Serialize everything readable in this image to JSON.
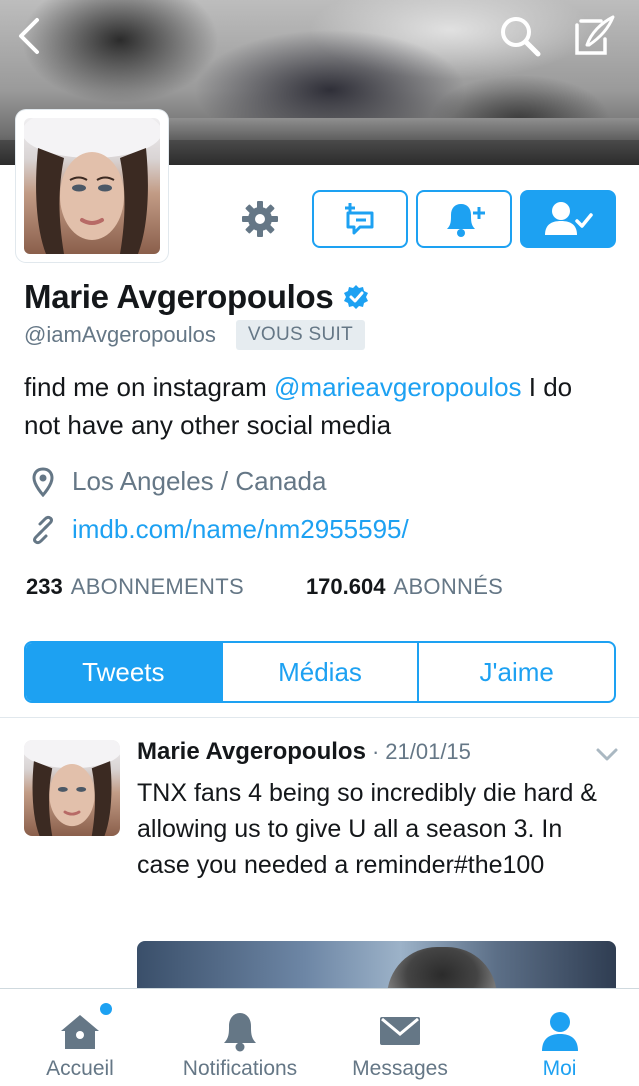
{
  "profile": {
    "name": "Marie Avgeropoulos",
    "handle": "@iamAvgeropoulos",
    "follows_you_badge": "VOUS SUIT",
    "verified": true,
    "bio_prefix": "find me on instagram ",
    "bio_mention": "@marieavgeropoulos",
    "bio_suffix": " I do not have any other social media",
    "location": "Los Angeles / Canada",
    "url": "imdb.com/name/nm2955595/"
  },
  "stats": {
    "following_count": "233",
    "following_label": "ABONNEMENTS",
    "followers_count": "170.604",
    "followers_label": "ABONNÉS"
  },
  "tabs": [
    {
      "label": "Tweets",
      "active": true
    },
    {
      "label": "Médias",
      "active": false
    },
    {
      "label": "J'aime",
      "active": false
    }
  ],
  "tweet": {
    "author": "Marie Avgeropoulos",
    "separator": "·",
    "date": "21/01/15",
    "text": "TNX fans 4 being so incredibly die hard & allowing us to give U all a season 3. In case you needed a reminder#the100"
  },
  "tabbar": {
    "items": [
      {
        "label": "Accueil",
        "icon": "home-icon",
        "has_badge": true
      },
      {
        "label": "Notifications",
        "icon": "bell-icon",
        "has_badge": false
      },
      {
        "label": "Messages",
        "icon": "envelope-icon",
        "has_badge": false
      },
      {
        "label": "Moi",
        "icon": "person-icon",
        "active": true
      }
    ]
  },
  "colors": {
    "accent": "#1da1f2",
    "secondary_text": "#657786",
    "primary_text": "#14171a"
  }
}
